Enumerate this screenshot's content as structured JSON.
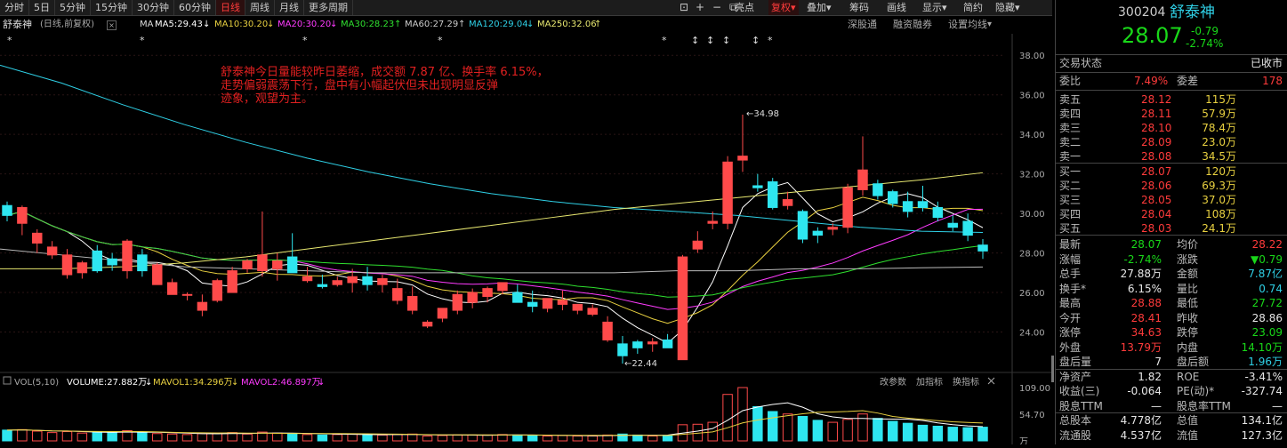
{
  "toolbar": {
    "tabs": [
      "分时",
      "5日",
      "5分钟",
      "15分钟",
      "30分钟",
      "60分钟",
      "日线",
      "周线",
      "月线",
      "更多周期"
    ],
    "active_tab": "日线",
    "right_tools": [
      "亮点",
      "复权",
      "叠加",
      "筹码",
      "画线",
      "显示",
      "简约",
      "隐藏"
    ],
    "right_tools_suffix": {
      "复权": "▾",
      "叠加": "▾",
      "显示": "▾",
      "隐藏": "▾"
    },
    "controls": [
      "⊡",
      "+",
      "−",
      "⧉"
    ]
  },
  "indicators": {
    "stock_label": "舒泰神",
    "mode": "(日线,前复权)",
    "ma_label": "MA",
    "ma5": "MA5:29.43",
    "ma10": "MA10:30.20",
    "ma20": "MA20:30.20",
    "ma30": "MA30:28.23",
    "ma60": "MA60:27.29",
    "ma120": "MA120:29.04",
    "ma250": "MA250:32.06",
    "links": [
      "深股通",
      "融资融券",
      "设置均线"
    ]
  },
  "annotation": "舒泰神今日量能较昨日萎缩，成交额 7.87 亿、换手率 6.15%，\n走势偏弱震荡下行，盘中有小幅起伏但未出现明显反弹\n迹象，观望为主。",
  "chart_data": {
    "type": "candlestick",
    "y_ticks": [
      "38.00",
      "36.00",
      "34.00",
      "32.00",
      "30.00",
      "28.00",
      "26.00",
      "24.00"
    ],
    "ylim": [
      22,
      39
    ],
    "high_label": "34.98",
    "low_label": "22.44",
    "ohlc": [
      [
        30.4,
        30.6,
        29.6,
        29.9
      ],
      [
        29.5,
        30.4,
        28.9,
        30.3
      ],
      [
        28.5,
        29.2,
        28.0,
        29.0
      ],
      [
        27.9,
        28.6,
        27.7,
        28.3
      ],
      [
        26.9,
        28.2,
        26.7,
        27.9
      ],
      [
        27.0,
        27.6,
        26.7,
        27.5
      ],
      [
        28.1,
        28.4,
        27.0,
        27.1
      ],
      [
        27.7,
        28.0,
        27.1,
        27.4
      ],
      [
        27.1,
        28.7,
        26.7,
        28.6
      ],
      [
        27.9,
        28.2,
        26.8,
        27.1
      ],
      [
        26.4,
        27.5,
        26.4,
        27.4
      ],
      [
        25.9,
        26.7,
        25.9,
        26.5
      ],
      [
        25.9,
        26.0,
        25.6,
        25.9
      ],
      [
        25.1,
        25.9,
        24.8,
        25.5
      ],
      [
        25.6,
        26.7,
        25.5,
        26.6
      ],
      [
        26.0,
        27.3,
        26.0,
        27.1
      ],
      [
        27.2,
        27.7,
        27.0,
        27.6
      ],
      [
        27.1,
        30.1,
        26.8,
        27.9
      ],
      [
        27.2,
        28.0,
        26.6,
        27.6
      ],
      [
        27.8,
        29.0,
        27.1,
        27.0
      ],
      [
        26.6,
        27.3,
        26.5,
        26.8
      ],
      [
        26.4,
        26.9,
        26.2,
        26.3
      ],
      [
        26.4,
        26.8,
        26.3,
        26.6
      ],
      [
        26.5,
        27.2,
        26.0,
        26.8
      ],
      [
        26.8,
        27.3,
        26.1,
        26.4
      ],
      [
        26.4,
        26.9,
        26.0,
        26.7
      ],
      [
        25.6,
        26.7,
        25.4,
        26.2
      ],
      [
        25.1,
        26.3,
        24.9,
        25.8
      ],
      [
        24.3,
        24.6,
        24.2,
        24.5
      ],
      [
        24.7,
        25.1,
        24.5,
        25.2
      ],
      [
        25.1,
        26.1,
        24.9,
        25.9
      ],
      [
        25.5,
        26.2,
        25.2,
        26.0
      ],
      [
        25.8,
        26.3,
        25.5,
        26.2
      ],
      [
        26.1,
        26.5,
        25.9,
        26.5
      ],
      [
        26.0,
        26.4,
        25.5,
        25.5
      ],
      [
        25.5,
        26.1,
        25.0,
        25.3
      ],
      [
        25.2,
        25.5,
        25.0,
        25.7
      ],
      [
        25.4,
        26.1,
        25.1,
        25.6
      ],
      [
        25.1,
        25.3,
        24.9,
        25.4
      ],
      [
        24.9,
        25.4,
        24.8,
        25.2
      ],
      [
        23.6,
        24.8,
        23.5,
        24.5
      ],
      [
        23.4,
        23.8,
        22.4,
        22.8
      ],
      [
        23.5,
        23.6,
        22.9,
        23.2
      ],
      [
        23.4,
        23.7,
        23.0,
        23.5
      ],
      [
        23.6,
        23.9,
        23.2,
        23.2
      ],
      [
        22.6,
        27.9,
        22.6,
        27.8
      ],
      [
        28.2,
        29.1,
        28.0,
        28.6
      ],
      [
        29.5,
        30.1,
        29.2,
        29.6
      ],
      [
        29.5,
        32.9,
        29.2,
        32.6
      ],
      [
        32.7,
        35.0,
        32.1,
        32.9
      ],
      [
        31.4,
        32.0,
        31.1,
        31.3
      ],
      [
        31.6,
        31.8,
        30.2,
        30.3
      ],
      [
        30.4,
        31.1,
        30.2,
        30.7
      ],
      [
        30.1,
        30.2,
        28.5,
        28.7
      ],
      [
        29.1,
        29.3,
        28.5,
        28.9
      ],
      [
        29.2,
        29.5,
        28.9,
        29.3
      ],
      [
        29.3,
        31.5,
        29.0,
        31.3
      ],
      [
        31.2,
        33.9,
        30.9,
        32.2
      ],
      [
        31.5,
        31.7,
        30.7,
        30.9
      ],
      [
        31.1,
        31.2,
        30.3,
        30.5
      ],
      [
        30.6,
        31.1,
        29.8,
        30.1
      ],
      [
        30.6,
        31.4,
        30.1,
        30.3
      ],
      [
        30.3,
        30.6,
        29.6,
        29.8
      ],
      [
        29.5,
        29.9,
        29.1,
        29.3
      ],
      [
        29.6,
        30.0,
        28.6,
        28.9
      ],
      [
        28.4,
        28.7,
        27.7,
        28.1
      ]
    ],
    "volume": {
      "label": "VOL(5,10)",
      "volume_text": "VOLUME:27.882万",
      "mavol1": "MAVOL1:34.296万",
      "mavol2": "MAVOL2:46.897万",
      "y_ticks": [
        "109.00",
        "54.70",
        "万"
      ],
      "links": [
        "改参数",
        "加指标",
        "换指标"
      ]
    }
  },
  "quote": {
    "code": "300204",
    "name": "舒泰神",
    "price": "28.07",
    "change": "-0.79",
    "change_pct": "-2.74%",
    "trade_state_label": "交易状态",
    "trade_state": "已收市",
    "weibi_label": "委比",
    "weibi": "7.49%",
    "weicha_label": "委差",
    "weicha": "178",
    "sell": [
      {
        "label": "卖五",
        "price": "28.12",
        "vol": "115万"
      },
      {
        "label": "卖四",
        "price": "28.11",
        "vol": "57.9万"
      },
      {
        "label": "卖三",
        "price": "28.10",
        "vol": "78.4万"
      },
      {
        "label": "卖二",
        "price": "28.09",
        "vol": "23.0万"
      },
      {
        "label": "卖一",
        "price": "28.08",
        "vol": "34.5万"
      }
    ],
    "buy": [
      {
        "label": "买一",
        "price": "28.07",
        "vol": "120万"
      },
      {
        "label": "买二",
        "price": "28.06",
        "vol": "69.3万"
      },
      {
        "label": "买三",
        "price": "28.05",
        "vol": "37.0万"
      },
      {
        "label": "买四",
        "price": "28.04",
        "vol": "108万"
      },
      {
        "label": "买五",
        "price": "28.03",
        "vol": "24.1万"
      }
    ],
    "stats": [
      {
        "l1": "最新",
        "v1": "28.07",
        "c1": "green",
        "l2": "均价",
        "v2": "28.22",
        "c2": "red"
      },
      {
        "l1": "涨幅",
        "v1": "-2.74%",
        "c1": "green",
        "l2": "涨跌",
        "v2": "▼0.79",
        "c2": "green"
      },
      {
        "l1": "总手",
        "v1": "27.88万",
        "c1": "white",
        "l2": "金额",
        "v2": "7.87亿",
        "c2": "cyan"
      },
      {
        "l1": "换手*",
        "v1": "6.15%",
        "c1": "white",
        "l2": "量比",
        "v2": "0.74",
        "c2": "cyan"
      },
      {
        "l1": "最高",
        "v1": "28.88",
        "c1": "red",
        "l2": "最低",
        "v2": "27.72",
        "c2": "green"
      },
      {
        "l1": "今开",
        "v1": "28.41",
        "c1": "red",
        "l2": "昨收",
        "v2": "28.86",
        "c2": "white"
      },
      {
        "l1": "涨停",
        "v1": "34.63",
        "c1": "red",
        "l2": "跌停",
        "v2": "23.09",
        "c2": "green"
      },
      {
        "l1": "外盘",
        "v1": "13.79万",
        "c1": "red",
        "l2": "内盘",
        "v2": "14.10万",
        "c2": "green"
      },
      {
        "l1": "盘后量",
        "v1": "7",
        "c1": "white",
        "l2": "盘后额",
        "v2": "1.96万",
        "c2": "cyan"
      },
      {
        "l1": "净资产",
        "v1": "1.82",
        "c1": "white",
        "l2": "ROE",
        "v2": "-3.41%",
        "c2": "white"
      },
      {
        "l1": "收益(三)",
        "v1": "-0.064",
        "c1": "white",
        "l2": "PE(动)*",
        "v2": "-327.74",
        "c2": "white"
      },
      {
        "l1": "股息TTM",
        "v1": "—",
        "c1": "white",
        "l2": "股息率TTM",
        "v2": "—",
        "c2": "white"
      },
      {
        "l1": "总股本",
        "v1": "4.778亿",
        "c1": "white",
        "l2": "总值",
        "v2": "134.1亿",
        "c2": "white"
      },
      {
        "l1": "流通股",
        "v1": "4.537亿",
        "c1": "white",
        "l2": "流值",
        "v2": "127.3亿",
        "c2": "white"
      }
    ]
  }
}
